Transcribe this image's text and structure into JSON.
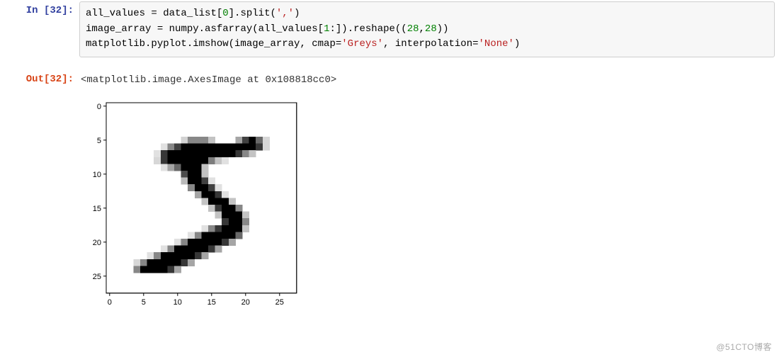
{
  "cell_in": {
    "prompt": "In [32]:",
    "code_lines": [
      [
        {
          "t": "all_values ",
          "c": ""
        },
        {
          "t": "=",
          "c": ""
        },
        {
          "t": " data_list[",
          "c": ""
        },
        {
          "t": "0",
          "c": "tk-green"
        },
        {
          "t": "].split(",
          "c": ""
        },
        {
          "t": "','",
          "c": "tk-red"
        },
        {
          "t": ")",
          "c": ""
        }
      ],
      [
        {
          "t": "image_array ",
          "c": ""
        },
        {
          "t": "=",
          "c": ""
        },
        {
          "t": " numpy.asfarray(all_values[",
          "c": ""
        },
        {
          "t": "1",
          "c": "tk-green"
        },
        {
          "t": ":]).reshape((",
          "c": ""
        },
        {
          "t": "28",
          "c": "tk-green"
        },
        {
          "t": ",",
          "c": ""
        },
        {
          "t": "28",
          "c": "tk-green"
        },
        {
          "t": "))",
          "c": ""
        }
      ],
      [
        {
          "t": "matplotlib.pyplot.imshow(image_array, cmap",
          "c": ""
        },
        {
          "t": "=",
          "c": ""
        },
        {
          "t": "'Greys'",
          "c": "tk-red"
        },
        {
          "t": ", interpolation",
          "c": ""
        },
        {
          "t": "=",
          "c": ""
        },
        {
          "t": "'None'",
          "c": "tk-red"
        },
        {
          "t": ")",
          "c": ""
        }
      ]
    ]
  },
  "cell_out": {
    "prompt": "Out[32]:",
    "text": "<matplotlib.image.AxesImage at 0x108818cc0>"
  },
  "chart_data": {
    "type": "heatmap",
    "title": "",
    "xlabel": "",
    "ylabel": "",
    "xlim": [
      0,
      27
    ],
    "ylim": [
      0,
      27
    ],
    "x_ticks": [
      0,
      5,
      10,
      15,
      20,
      25
    ],
    "y_ticks": [
      0,
      5,
      10,
      15,
      20,
      25
    ],
    "cmap": "Greys",
    "interpolation": "None",
    "grid_shape": [
      28,
      28
    ],
    "values": [
      [
        0,
        0,
        0,
        0,
        0,
        0,
        0,
        0,
        0,
        0,
        0,
        0,
        0,
        0,
        0,
        0,
        0,
        0,
        0,
        0,
        0,
        0,
        0,
        0,
        0,
        0,
        0,
        0
      ],
      [
        0,
        0,
        0,
        0,
        0,
        0,
        0,
        0,
        0,
        0,
        0,
        0,
        0,
        0,
        0,
        0,
        0,
        0,
        0,
        0,
        0,
        0,
        0,
        0,
        0,
        0,
        0,
        0
      ],
      [
        0,
        0,
        0,
        0,
        0,
        0,
        0,
        0,
        0,
        0,
        0,
        0,
        0,
        0,
        0,
        0,
        0,
        0,
        0,
        0,
        0,
        0,
        0,
        0,
        0,
        0,
        0,
        0
      ],
      [
        0,
        0,
        0,
        0,
        0,
        0,
        0,
        0,
        0,
        0,
        0,
        0,
        0,
        0,
        0,
        0,
        0,
        0,
        0,
        0,
        0,
        0,
        0,
        0,
        0,
        0,
        0,
        0
      ],
      [
        0,
        0,
        0,
        0,
        0,
        0,
        0,
        0,
        0,
        0,
        0,
        0,
        0,
        0,
        0,
        0,
        0,
        0,
        0,
        0,
        0,
        0,
        0,
        0,
        0,
        0,
        0,
        0
      ],
      [
        0,
        0,
        0,
        0,
        0,
        0,
        0,
        0,
        0,
        0,
        0,
        45,
        120,
        120,
        120,
        60,
        0,
        0,
        0,
        90,
        190,
        255,
        150,
        40,
        0,
        0,
        0,
        0
      ],
      [
        0,
        0,
        0,
        0,
        0,
        0,
        0,
        0,
        30,
        120,
        190,
        255,
        255,
        255,
        255,
        255,
        255,
        255,
        255,
        255,
        255,
        255,
        200,
        40,
        0,
        0,
        0,
        0
      ],
      [
        0,
        0,
        0,
        0,
        0,
        0,
        0,
        30,
        200,
        255,
        255,
        255,
        255,
        255,
        255,
        255,
        255,
        255,
        255,
        200,
        120,
        60,
        0,
        0,
        0,
        0,
        0,
        0
      ],
      [
        0,
        0,
        0,
        0,
        0,
        0,
        0,
        40,
        200,
        255,
        255,
        255,
        255,
        255,
        255,
        130,
        60,
        30,
        0,
        0,
        0,
        0,
        0,
        0,
        0,
        0,
        0,
        0
      ],
      [
        0,
        0,
        0,
        0,
        0,
        0,
        0,
        0,
        30,
        90,
        150,
        255,
        255,
        255,
        60,
        0,
        0,
        0,
        0,
        0,
        0,
        0,
        0,
        0,
        0,
        0,
        0,
        0
      ],
      [
        0,
        0,
        0,
        0,
        0,
        0,
        0,
        0,
        0,
        0,
        0,
        180,
        255,
        255,
        60,
        0,
        0,
        0,
        0,
        0,
        0,
        0,
        0,
        0,
        0,
        0,
        0,
        0
      ],
      [
        0,
        0,
        0,
        0,
        0,
        0,
        0,
        0,
        0,
        0,
        0,
        70,
        255,
        255,
        190,
        30,
        0,
        0,
        0,
        0,
        0,
        0,
        0,
        0,
        0,
        0,
        0,
        0
      ],
      [
        0,
        0,
        0,
        0,
        0,
        0,
        0,
        0,
        0,
        0,
        0,
        0,
        120,
        255,
        255,
        190,
        30,
        0,
        0,
        0,
        0,
        0,
        0,
        0,
        0,
        0,
        0,
        0
      ],
      [
        0,
        0,
        0,
        0,
        0,
        0,
        0,
        0,
        0,
        0,
        0,
        0,
        0,
        90,
        255,
        255,
        200,
        30,
        0,
        0,
        0,
        0,
        0,
        0,
        0,
        0,
        0,
        0
      ],
      [
        0,
        0,
        0,
        0,
        0,
        0,
        0,
        0,
        0,
        0,
        0,
        0,
        0,
        0,
        60,
        255,
        255,
        255,
        60,
        0,
        0,
        0,
        0,
        0,
        0,
        0,
        0,
        0
      ],
      [
        0,
        0,
        0,
        0,
        0,
        0,
        0,
        0,
        0,
        0,
        0,
        0,
        0,
        0,
        0,
        60,
        200,
        255,
        255,
        120,
        0,
        0,
        0,
        0,
        0,
        0,
        0,
        0
      ],
      [
        0,
        0,
        0,
        0,
        0,
        0,
        0,
        0,
        0,
        0,
        0,
        0,
        0,
        0,
        0,
        0,
        60,
        255,
        255,
        255,
        60,
        0,
        0,
        0,
        0,
        0,
        0,
        0
      ],
      [
        0,
        0,
        0,
        0,
        0,
        0,
        0,
        0,
        0,
        0,
        0,
        0,
        0,
        0,
        0,
        0,
        0,
        200,
        255,
        255,
        120,
        0,
        0,
        0,
        0,
        0,
        0,
        0
      ],
      [
        0,
        0,
        0,
        0,
        0,
        0,
        0,
        0,
        0,
        0,
        0,
        0,
        0,
        0,
        30,
        120,
        200,
        255,
        255,
        255,
        60,
        0,
        0,
        0,
        0,
        0,
        0,
        0
      ],
      [
        0,
        0,
        0,
        0,
        0,
        0,
        0,
        0,
        0,
        0,
        0,
        0,
        30,
        120,
        255,
        255,
        255,
        255,
        255,
        150,
        0,
        0,
        0,
        0,
        0,
        0,
        0,
        0
      ],
      [
        0,
        0,
        0,
        0,
        0,
        0,
        0,
        0,
        0,
        0,
        30,
        120,
        255,
        255,
        255,
        255,
        255,
        200,
        90,
        0,
        0,
        0,
        0,
        0,
        0,
        0,
        0,
        0
      ],
      [
        0,
        0,
        0,
        0,
        0,
        0,
        0,
        0,
        30,
        120,
        255,
        255,
        255,
        255,
        255,
        200,
        90,
        0,
        0,
        0,
        0,
        0,
        0,
        0,
        0,
        0,
        0,
        0
      ],
      [
        0,
        0,
        0,
        0,
        0,
        0,
        30,
        120,
        255,
        255,
        255,
        255,
        255,
        200,
        90,
        0,
        0,
        0,
        0,
        0,
        0,
        0,
        0,
        0,
        0,
        0,
        0,
        0
      ],
      [
        0,
        0,
        0,
        0,
        40,
        120,
        255,
        255,
        255,
        255,
        255,
        200,
        90,
        0,
        0,
        0,
        0,
        0,
        0,
        0,
        0,
        0,
        0,
        0,
        0,
        0,
        0,
        0
      ],
      [
        0,
        0,
        0,
        0,
        120,
        255,
        255,
        255,
        255,
        200,
        90,
        0,
        0,
        0,
        0,
        0,
        0,
        0,
        0,
        0,
        0,
        0,
        0,
        0,
        0,
        0,
        0,
        0
      ],
      [
        0,
        0,
        0,
        0,
        0,
        0,
        0,
        0,
        0,
        0,
        0,
        0,
        0,
        0,
        0,
        0,
        0,
        0,
        0,
        0,
        0,
        0,
        0,
        0,
        0,
        0,
        0,
        0
      ],
      [
        0,
        0,
        0,
        0,
        0,
        0,
        0,
        0,
        0,
        0,
        0,
        0,
        0,
        0,
        0,
        0,
        0,
        0,
        0,
        0,
        0,
        0,
        0,
        0,
        0,
        0,
        0,
        0
      ],
      [
        0,
        0,
        0,
        0,
        0,
        0,
        0,
        0,
        0,
        0,
        0,
        0,
        0,
        0,
        0,
        0,
        0,
        0,
        0,
        0,
        0,
        0,
        0,
        0,
        0,
        0,
        0,
        0
      ]
    ]
  },
  "watermark": "@51CTO博客"
}
